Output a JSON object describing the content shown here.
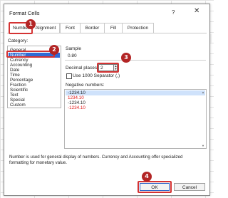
{
  "dialog": {
    "title": "Format Cells",
    "help": "?",
    "close": "✕"
  },
  "tabs": [
    {
      "label": "Number"
    },
    {
      "label": "Alignment"
    },
    {
      "label": "Font"
    },
    {
      "label": "Border"
    },
    {
      "label": "Fill"
    },
    {
      "label": "Protection"
    }
  ],
  "category": {
    "label": "Category:",
    "items": [
      "General",
      "Number",
      "Currency",
      "Accounting",
      "Date",
      "Time",
      "Percentage",
      "Fraction",
      "Scientific",
      "Text",
      "Special",
      "Custom"
    ],
    "selected": "Number"
  },
  "sample": {
    "label": "Sample",
    "value": "0.80"
  },
  "decimal_places": {
    "label": "Decimal places:",
    "value": "2"
  },
  "separator": {
    "label": "Use 1000 Separator (,)",
    "checked": false
  },
  "negative_numbers": {
    "label": "Negative numbers:",
    "items": [
      {
        "text": "-1234.10",
        "color": "#222222"
      },
      {
        "text": "1234.10",
        "color": "#e21b1b"
      },
      {
        "text": "-1234.10",
        "color": "#222222"
      },
      {
        "text": "-1234.10",
        "color": "#e21b1b"
      }
    ]
  },
  "description": "Number is used for general display of numbers.  Currency and Accounting offer specialized formatting for monetary value.",
  "buttons": {
    "ok": "OK",
    "cancel": "Cancel"
  },
  "badges": [
    "1",
    "2",
    "3",
    "4"
  ],
  "accent": "#2f6bd6",
  "highlight": "#d43333"
}
